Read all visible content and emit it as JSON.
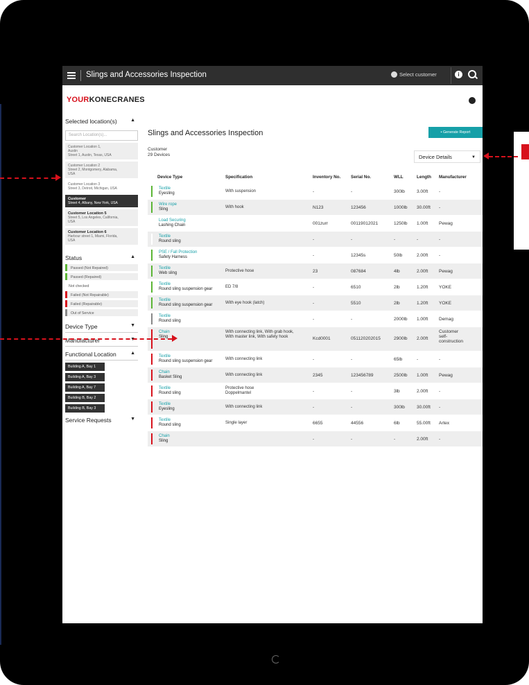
{
  "app": {
    "title": "Slings and Accessories Inspection",
    "select_customer": "Select customer",
    "info": "i"
  },
  "logo": {
    "red": "YOUR",
    "black": "KONECRANES"
  },
  "sidebar": {
    "locations_head": "Selected location(s)",
    "search_placeholder": "Search Location(s)...",
    "locations": [
      {
        "name": "Customer Location 1,",
        "addr1": "Austin",
        "addr2": "Street 1, Austin, Texas, USA"
      },
      {
        "name": "Customer Location 2",
        "addr1": "Street 2, Montgomery, Alabama,",
        "addr2": "USA"
      },
      {
        "name": "Customer Location 3",
        "addr1": "Street 3, Detroit, Michigan, USA",
        "addr2": ""
      },
      {
        "name": "Customer",
        "addr1": "Street 4, Albany, New York, USA",
        "addr2": ""
      },
      {
        "name": "Customer Location 5",
        "addr1": "Street 5, Los Angeles, California,",
        "addr2": "USA"
      },
      {
        "name": "Customer Location 6",
        "addr1": "Harbour street 1, Miami, Florida,",
        "addr2": "USA"
      }
    ],
    "status_head": "Status",
    "statuses": [
      "Passed (Not Repaired)",
      "Passed (Repaired)",
      "Not checked",
      "Failed (Not Repairable)",
      "Failed (Repairable)",
      "Out of Service"
    ],
    "device_type": "Device Type",
    "manufacturer": "Manufacturer",
    "functional_location": "Functional Location",
    "buildings": [
      "Building A, Bay 1",
      "Building A, Bay 3",
      "Building A, Bay 7",
      "Building B, Bay 2",
      "Building B, Bay 3"
    ],
    "service_requests": "Service Requests"
  },
  "main": {
    "title": "Slings and Accessories Inspection",
    "generate_report": "Generate Report",
    "customer_label": "Customer",
    "device_count": "29 Devices",
    "device_details": "Device Details",
    "columns": [
      "Device Type",
      "Specification",
      "Inventory No.",
      "Serial No.",
      "WLL",
      "Length",
      "Manufacturer"
    ],
    "rows": [
      {
        "cat": "Textile",
        "type": "Eyesling",
        "spec": "With suspension",
        "inv": "-",
        "serial": "-",
        "wll": "300lb",
        "len": "3.00ft",
        "mfr": "-",
        "color": "#5bb535"
      },
      {
        "cat": "Wire rope",
        "type": "Sling",
        "spec": "With hook",
        "inv": "N123",
        "serial": "123456",
        "wll": "1000lb",
        "len": "30.00ft",
        "mfr": "-",
        "color": "#5bb535"
      },
      {
        "cat": "Load Securing",
        "type": "Lashing Chain",
        "spec": "",
        "inv": "001zurr",
        "serial": "00119012021",
        "wll": "1250lb",
        "len": "1.00ft",
        "mfr": "Pewag",
        "color": "#ffffff"
      },
      {
        "cat": "Textile",
        "type": "Round sling",
        "spec": "",
        "inv": "-",
        "serial": "-",
        "wll": "-",
        "len": "-",
        "mfr": "-",
        "color": "#ffffff"
      },
      {
        "cat": "PSE / Fall Protection",
        "type": "Safety Harness",
        "spec": "",
        "inv": "-",
        "serial": "12345s",
        "wll": "50lb",
        "len": "2.00ft",
        "mfr": "-",
        "color": "#5bb535"
      },
      {
        "cat": "Textile",
        "type": "Web sling",
        "spec": "Protective hose",
        "inv": "23",
        "serial": "087684",
        "wll": "4lb",
        "len": "2.00ft",
        "mfr": "Pewag",
        "color": "#5bb535"
      },
      {
        "cat": "Textile",
        "type": "Round sling suspension gear",
        "spec": "ED 7/8",
        "inv": "-",
        "serial": "6510",
        "wll": "2lb",
        "len": "1.20ft",
        "mfr": "YOKE",
        "color": "#5bb535"
      },
      {
        "cat": "Textile",
        "type": "Round sling suspension gear",
        "spec": "With eye hook (latch)",
        "inv": "-",
        "serial": "5510",
        "wll": "2lb",
        "len": "1.20ft",
        "mfr": "YOKE",
        "color": "#5bb535"
      },
      {
        "cat": "Textile",
        "type": "Round sling",
        "spec": "",
        "inv": "-",
        "serial": "-",
        "wll": "2000lb",
        "len": "1.00ft",
        "mfr": "Demag",
        "color": "#888888"
      },
      {
        "cat": "Chain",
        "type": "Sling",
        "spec": "With connecting link, With grab hook,",
        "spec2": "With master link, With safety hook",
        "inv": "Kcd0001",
        "serial": "051120202015",
        "wll": "2900lb",
        "len": "2.00ft",
        "mfr": "Customer",
        "mfr2": "self-",
        "mfr3": "construction",
        "color": "#d7111c"
      },
      {
        "cat": "Textile",
        "type": "Round sling suspension gear",
        "spec": "With connecting link",
        "inv": "-",
        "serial": "-",
        "wll": "65lb",
        "len": "-",
        "mfr": "-",
        "color": "#d7111c"
      },
      {
        "cat": "Chain",
        "type": "Basket Sling",
        "spec": "With connecting link",
        "inv": "2345",
        "serial": "123456789",
        "wll": "2500lb",
        "len": "1.00ft",
        "mfr": "Pewag",
        "color": "#d7111c"
      },
      {
        "cat": "Textile",
        "type": "Round sling",
        "spec": "Protective hose",
        "spec2": "Doppelmantel",
        "inv": "-",
        "serial": "-",
        "wll": "3lb",
        "len": "2.00ft",
        "mfr": "-",
        "color": "#d7111c"
      },
      {
        "cat": "Textile",
        "type": "Eyesling",
        "spec": "With connecting link",
        "inv": "-",
        "serial": "-",
        "wll": "300lb",
        "len": "30.00ft",
        "mfr": "-",
        "color": "#d7111c"
      },
      {
        "cat": "Textile",
        "type": "Round sling",
        "spec": "Single layer",
        "inv": "6655",
        "serial": "44556",
        "wll": "6lb",
        "len": "55.00ft",
        "mfr": "Artex",
        "color": "#d7111c"
      },
      {
        "cat": "Chain",
        "type": "Sling",
        "spec": "",
        "inv": "-",
        "serial": "-",
        "wll": "-",
        "len": "2.00ft",
        "mfr": "-",
        "color": "#d7111c"
      }
    ]
  },
  "colors": {
    "accent": "#16a0a8",
    "brand_red": "#d7111c",
    "topbar": "#2f2f2f",
    "pass": "#5bb535"
  }
}
